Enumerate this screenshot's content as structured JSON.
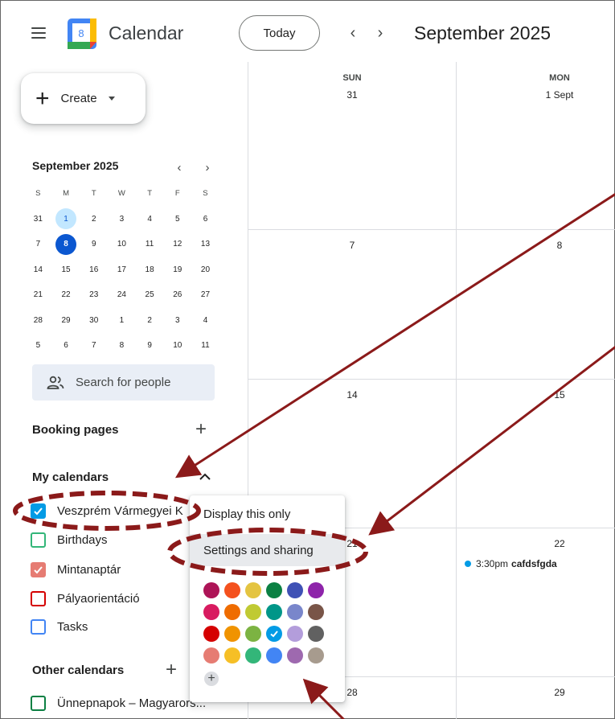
{
  "header": {
    "app_title": "Calendar",
    "logo_day": "8",
    "today_label": "Today",
    "prev_icon": "chevron-left-icon",
    "next_icon": "chevron-right-icon",
    "period_title": "September 2025"
  },
  "create": {
    "label": "Create",
    "plus": "+"
  },
  "mini_calendar": {
    "title": "September 2025",
    "weekday_heads": [
      "S",
      "M",
      "T",
      "W",
      "T",
      "F",
      "S"
    ],
    "weeks": [
      [
        "31",
        "1",
        "2",
        "3",
        "4",
        "5",
        "6"
      ],
      [
        "7",
        "8",
        "9",
        "10",
        "11",
        "12",
        "13"
      ],
      [
        "14",
        "15",
        "16",
        "17",
        "18",
        "19",
        "20"
      ],
      [
        "21",
        "22",
        "23",
        "24",
        "25",
        "26",
        "27"
      ],
      [
        "28",
        "29",
        "30",
        "1",
        "2",
        "3",
        "4"
      ],
      [
        "5",
        "6",
        "7",
        "8",
        "9",
        "10",
        "11"
      ]
    ],
    "today_highlight": "1",
    "selected": "8"
  },
  "search_people": {
    "placeholder": "Search for people",
    "icon": "people-icon"
  },
  "booking": {
    "title": "Booking pages",
    "add": "+"
  },
  "my_calendars": {
    "title": "My calendars",
    "items": [
      {
        "label": "Veszprém Vármegyei K",
        "color": "#039be5",
        "checked": true
      },
      {
        "label": "Birthdays",
        "color": "#33b679",
        "checked": false
      },
      {
        "label": "Mintanaptár",
        "color": "#e67c73",
        "checked": true
      },
      {
        "label": "Pályaorientáció",
        "color": "#d50000",
        "checked": false
      },
      {
        "label": "Tasks",
        "color": "#4285f4",
        "checked": false
      }
    ]
  },
  "other_calendars": {
    "title": "Other calendars",
    "add": "+",
    "items": [
      {
        "label": "Ünnepnapok – Magyarors...",
        "color": "#0b8043",
        "checked": false
      }
    ]
  },
  "week_grid": {
    "days": [
      {
        "name": "SUN",
        "num": "31"
      },
      {
        "name": "MON",
        "num": "1 Sept"
      }
    ],
    "rows": [
      [
        "7",
        "8"
      ],
      [
        "14",
        "15"
      ],
      [
        "21",
        "22"
      ],
      [
        "28",
        "29"
      ]
    ]
  },
  "event": {
    "time": "3:30pm",
    "title": "cafdsfgda",
    "color": "#039be5"
  },
  "context_menu": {
    "display_only": "Display this only",
    "settings_sharing": "Settings and sharing",
    "swatches": [
      "#ad1457",
      "#f4511e",
      "#e4c441",
      "#0b8043",
      "#3f51b5",
      "#8e24aa",
      "#d81b60",
      "#ef6c00",
      "#c0ca33",
      "#009688",
      "#7986cb",
      "#795548",
      "#d50000",
      "#f09300",
      "#7cb342",
      "#039be5",
      "#b39ddb",
      "#616161",
      "#e67c73",
      "#f6bf26",
      "#33b679",
      "#4285f4",
      "#9e69af",
      "#a79b8e"
    ],
    "selected_swatch": "#039be5",
    "add_color": "+"
  },
  "annotation_color": "#8b1a1a"
}
